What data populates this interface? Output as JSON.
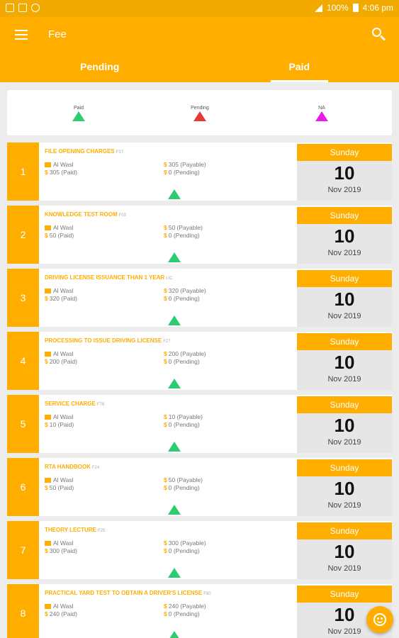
{
  "statusbar": {
    "battery": "100%",
    "time": "4:06 pm"
  },
  "header": {
    "title": "Fee"
  },
  "tabs": [
    {
      "label": "Pending"
    },
    {
      "label": "Paid"
    }
  ],
  "legend": [
    {
      "label": "Paid",
      "color": "#2ecc71"
    },
    {
      "label": "Pending",
      "color": "#e53935"
    },
    {
      "label": "NA",
      "color": "#e91ee6"
    }
  ],
  "fees": [
    {
      "index": "1",
      "name": "FILE OPENING CHARGES",
      "code": "F37",
      "location": "Al Wasl",
      "paid": "305 (Paid)",
      "payable": "305 (Payable)",
      "pending": "0 (Pending)",
      "day": "Sunday",
      "date": "10",
      "month_year": "Nov 2019"
    },
    {
      "index": "2",
      "name": "KNOWLEDGE TEST ROOM",
      "code": "F03",
      "location": "Al Wasl",
      "paid": "50 (Paid)",
      "payable": "50 (Payable)",
      "pending": "0 (Pending)",
      "day": "Sunday",
      "date": "10",
      "month_year": "Nov 2019"
    },
    {
      "index": "3",
      "name": "DRIVING LICENSE ISSUANCE THAN 1 YEAR",
      "code": "LIC",
      "location": "Al Wasl",
      "paid": "320 (Paid)",
      "payable": "320 (Payable)",
      "pending": "0 (Pending)",
      "day": "Sunday",
      "date": "10",
      "month_year": "Nov 2019"
    },
    {
      "index": "4",
      "name": "PROCESSING TO ISSUE DRIVING LICENSE",
      "code": "F27",
      "location": "Al Wasl",
      "paid": "200 (Paid)",
      "payable": "200 (Payable)",
      "pending": "0 (Pending)",
      "day": "Sunday",
      "date": "10",
      "month_year": "Nov 2019"
    },
    {
      "index": "5",
      "name": "SERVICE CHARGE",
      "code": "F78",
      "location": "Al Wasl",
      "paid": "10 (Paid)",
      "payable": "10 (Payable)",
      "pending": "0 (Pending)",
      "day": "Sunday",
      "date": "10",
      "month_year": "Nov 2019"
    },
    {
      "index": "6",
      "name": "RTA HANDBOOK",
      "code": "F24",
      "location": "Al Wasl",
      "paid": "50 (Paid)",
      "payable": "50 (Payable)",
      "pending": "0 (Pending)",
      "day": "Sunday",
      "date": "10",
      "month_year": "Nov 2019"
    },
    {
      "index": "7",
      "name": "THEORY LECTURE",
      "code": "F25",
      "location": "Al Wasl",
      "paid": "300 (Paid)",
      "payable": "300 (Payable)",
      "pending": "0 (Pending)",
      "day": "Sunday",
      "date": "10",
      "month_year": "Nov 2019"
    },
    {
      "index": "8",
      "name": "PRACTICAL YARD TEST TO OBTAIN A DRIVER'S LICENSE",
      "code": "F80",
      "location": "Al Wasl",
      "paid": "240 (Paid)",
      "payable": "240 (Payable)",
      "pending": "0 (Pending)",
      "day": "Sunday",
      "date": "10",
      "month_year": "Nov 2019"
    }
  ]
}
